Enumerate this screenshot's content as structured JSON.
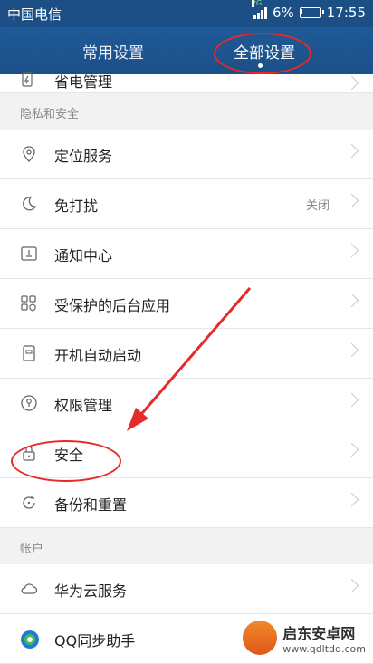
{
  "status": {
    "carrier": "中国电信",
    "network": "2G",
    "battery": "6%",
    "battery_level": 0.06,
    "time": "17:55"
  },
  "tabs": [
    {
      "label": "常用设置"
    },
    {
      "label": "全部设置"
    }
  ],
  "rows": {
    "battery": {
      "label": "省电管理"
    },
    "location": {
      "label": "定位服务"
    },
    "dnd": {
      "label": "免打扰",
      "value": "关闭"
    },
    "notify": {
      "label": "通知中心"
    },
    "protected": {
      "label": "受保护的后台应用"
    },
    "autostart": {
      "label": "开机自动启动"
    },
    "permission": {
      "label": "权限管理"
    },
    "security": {
      "label": "安全"
    },
    "backup": {
      "label": "备份和重置"
    },
    "cloud": {
      "label": "华为云服务"
    },
    "qq": {
      "label": "QQ同步助手"
    }
  },
  "sections": {
    "privacy": "隐私和安全",
    "account": "帐户"
  },
  "watermark": {
    "name": "启东安卓网",
    "url": "www.qdltdq.com"
  },
  "colors": {
    "header": "#1c4f88",
    "annotation": "#e32b2b"
  }
}
